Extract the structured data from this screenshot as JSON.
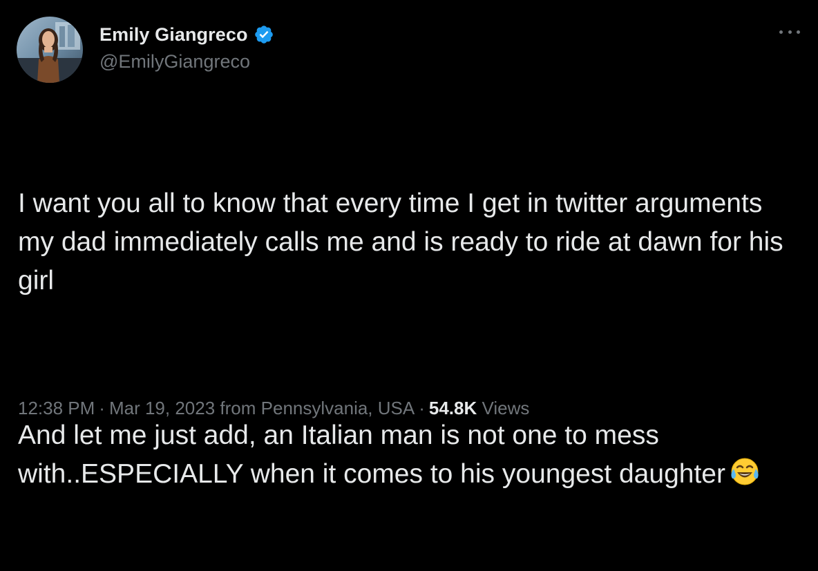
{
  "author": {
    "display_name": "Emily Giangreco",
    "handle": "@EmilyGiangreco",
    "verified_icon": "verified-badge-icon",
    "verified_color": "#1d9bf0"
  },
  "menu": {
    "icon": "more-options-icon"
  },
  "tweet": {
    "paragraph_1": "I want you all to know that every time I get in twitter arguments my dad immediately calls me and is ready to ride at dawn for his girl",
    "paragraph_2": "And let me just add, an Italian man is not one to mess with..ESPECIALLY when it comes to his youngest daughter",
    "emoji": "face-with-tears-of-joy-emoji"
  },
  "meta": {
    "time": "12:38 PM",
    "date": "Mar 19, 2023",
    "source": "from Pennsylvania, USA",
    "views_count": "54.8K",
    "views_label": "Views",
    "separator": "·"
  },
  "colors": {
    "background": "#000000",
    "primary_text": "#e7e9ea",
    "secondary_text": "#71767b",
    "accent": "#1d9bf0"
  }
}
